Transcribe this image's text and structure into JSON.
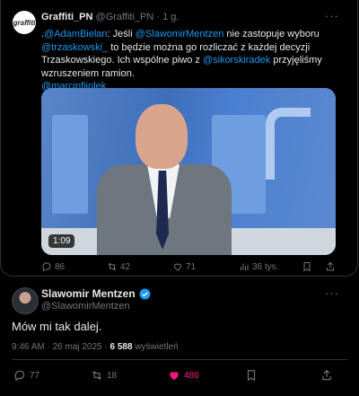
{
  "quoted_tweet": {
    "author_name": "Graffiti_PN",
    "handle": "@Graffiti_PN",
    "separator": "·",
    "time": "1 g.",
    "avatar_text": "graffiti",
    "text": {
      "prefix": ".",
      "mention1": "@AdamBielan",
      "part1": ": Jeśli ",
      "mention2": "@SlawomirMentzen",
      "part2": " nie zastopuje wyboru ",
      "mention3": "@trzaskowski_",
      "part3": " to będzie można go rozliczać z każdej decyzji Trzaskowskiego. Ich wspólne piwo z ",
      "mention4": "@sikorskiradek",
      "part4": " przyjęliśmy wzruszeniem ramion.",
      "mention5": "@marcinfijolek"
    },
    "video_duration": "1:09",
    "actions": {
      "replies": "86",
      "reposts": "42",
      "likes": "71",
      "views": "36 tys."
    }
  },
  "reply_tweet": {
    "author_name": "Slawomir Mentzen",
    "handle": "@SlawomirMentzen",
    "text": "Mów mi tak dalej.",
    "time": "9:46 AM · 26 maj 2025 · ",
    "views_count": "6 588",
    "views_label": " wyświetleń",
    "actions": {
      "replies": "77",
      "reposts": "18",
      "likes": "486"
    },
    "like_color": "#f91880"
  }
}
